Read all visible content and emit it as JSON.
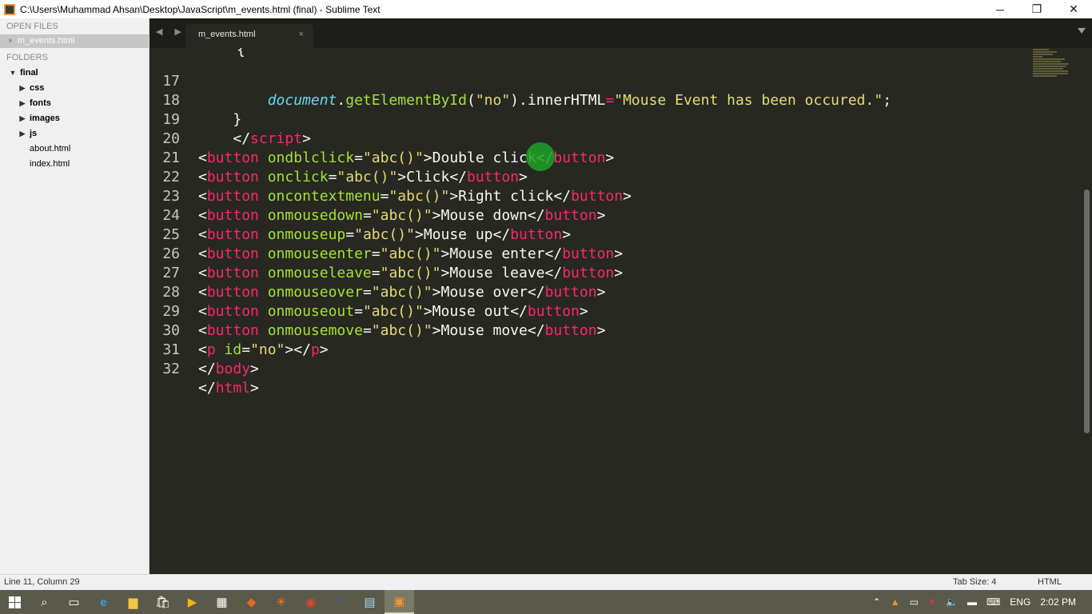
{
  "window": {
    "title": "C:\\Users\\Muhammad Ahsan\\Desktop\\JavaScript\\m_events.html (final) - Sublime Text",
    "minimize": "─",
    "restore": "❐",
    "close": "✕"
  },
  "sidebar": {
    "open_files_label": "OPEN FILES",
    "open_files": [
      {
        "name": "m_events.html",
        "close": "×"
      }
    ],
    "folders_label": "FOLDERS",
    "tree": [
      {
        "label": "final",
        "arrow": "▼"
      },
      {
        "label": "css",
        "arrow": "▶"
      },
      {
        "label": "fonts",
        "arrow": "▶"
      },
      {
        "label": "images",
        "arrow": "▶"
      },
      {
        "label": "js",
        "arrow": "▶"
      },
      {
        "label": "about.html"
      },
      {
        "label": "index.html"
      }
    ]
  },
  "tabbar": {
    "nav": "◀ ▶",
    "tab_label": "m_events.html",
    "tab_close": "×"
  },
  "editor": {
    "partial_line": "{",
    "line_numbers": [
      "17",
      "18",
      "19",
      "20",
      "21",
      "22",
      "23",
      "24",
      "25",
      "26",
      "27",
      "28",
      "29",
      "30",
      "31",
      "32"
    ],
    "lines": {
      "l17": {
        "indent": "        ",
        "obj": "document",
        "dot1": ".",
        "fn": "getElementById",
        "p1": "(",
        "s1": "\"no\"",
        "p2": ").",
        "prop": "innerHTML",
        "eq": "=",
        "s2": "\"Mouse Event has been occured.\"",
        "end": ";"
      },
      "l18": {
        "text": "    }"
      },
      "l19": {
        "indent": "    ",
        "open": "</",
        "tag": "script",
        "close": ">"
      },
      "buttons": [
        {
          "attr": "ondblclick",
          "label": "Double click"
        },
        {
          "attr": "onclick",
          "label": "Click"
        },
        {
          "attr": "oncontextmenu",
          "label": "Right click"
        },
        {
          "attr": "onmousedown",
          "label": "Mouse down"
        },
        {
          "attr": "onmouseup",
          "label": "Mouse up"
        },
        {
          "attr": "onmouseenter",
          "label": "Mouse enter"
        },
        {
          "attr": "onmouseleave",
          "label": "Mouse leave"
        },
        {
          "attr": "onmouseover",
          "label": "Mouse over"
        },
        {
          "attr": "onmouseout",
          "label": "Mouse out"
        },
        {
          "attr": "onmousemove",
          "label": "Mouse move"
        }
      ],
      "btn_tag": "button",
      "btn_value": "\"abc()\"",
      "l30": {
        "tag": "p",
        "attr": "id",
        "value": "\"no\""
      },
      "l31": {
        "tag": "body"
      },
      "l32": {
        "tag": "html"
      }
    }
  },
  "statusbar": {
    "position": "Line 11, Column 29",
    "tab_size": "Tab Size: 4",
    "syntax": "HTML"
  },
  "taskbar": {
    "language": "ENG",
    "time": "2:02 PM"
  },
  "colors": {
    "editor_bg": "#272822",
    "tag": "#f92672",
    "attribute": "#a6e22e",
    "string": "#e6db74",
    "identifier": "#66d9ef"
  }
}
